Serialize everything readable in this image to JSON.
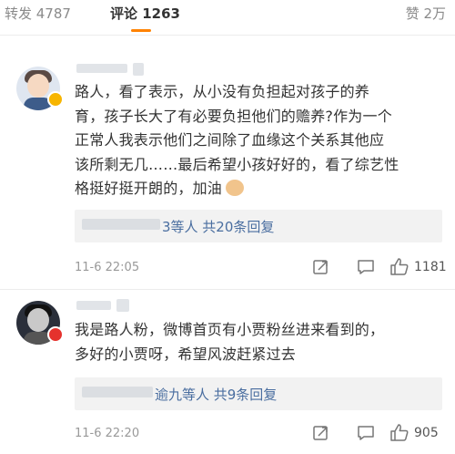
{
  "tabs": {
    "repost": "转发 4787",
    "comment": "评论 1263",
    "like": "赞 2万"
  },
  "colors": {
    "accent": "#ff8200",
    "link": "#4a6ea0"
  },
  "comments": [
    {
      "lines": [
        "路人，看了表示，从小没有负担起对孩子的养",
        "育，孩子长大了有必要负担他们的赡养?作为一个",
        "正常人我表示他们之间除了血缘这个关系其他应",
        "该所剩无几……最后希望小孩好好的，看了综艺性",
        "格挺好挺开朗的，加油"
      ],
      "emoji": "clapping-hands-emoji",
      "replies_text": "3等人 共20条回复",
      "time": "11-6 22:05",
      "likes": "1181"
    },
    {
      "lines": [
        "我是路人粉，微博首页有小贾粉丝进来看到的，",
        "多好的小贾呀，希望风波赶紧过去"
      ],
      "replies_text": "逾九等人 共9条回复",
      "time": "11-6 22:20",
      "likes": "905"
    }
  ]
}
